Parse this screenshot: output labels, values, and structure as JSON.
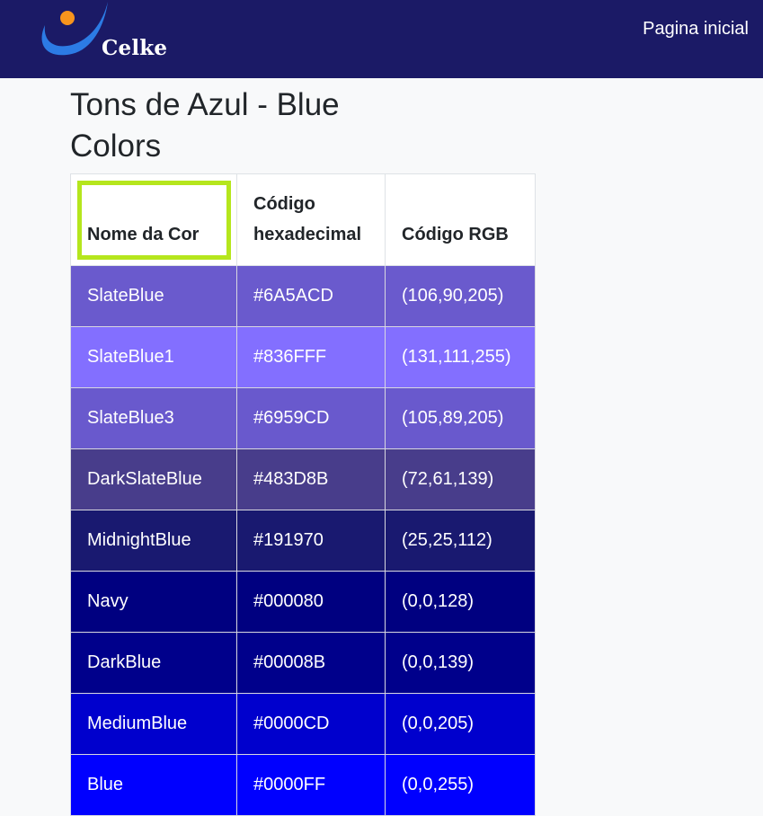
{
  "navbar": {
    "brand": "Celke",
    "link": "Pagina inicial"
  },
  "page": {
    "title": "Tons de Azul - Blue Colors"
  },
  "table": {
    "headers": [
      "Nome da Cor",
      "Código hexadecimal",
      "Código RGB"
    ],
    "rows": [
      {
        "name": "SlateBlue",
        "hex": "#6A5ACD",
        "rgb": "(106,90,205)",
        "color": "#6A5ACD"
      },
      {
        "name": "SlateBlue1",
        "hex": "#836FFF",
        "rgb": "(131,111,255)",
        "color": "#836FFF"
      },
      {
        "name": "SlateBlue3",
        "hex": "#6959CD",
        "rgb": "(105,89,205)",
        "color": "#6959CD"
      },
      {
        "name": "DarkSlateBlue",
        "hex": "#483D8B",
        "rgb": "(72,61,139)",
        "color": "#483D8B"
      },
      {
        "name": "MidnightBlue",
        "hex": "#191970",
        "rgb": "(25,25,112)",
        "color": "#191970"
      },
      {
        "name": "Navy",
        "hex": "#000080",
        "rgb": "(0,0,128)",
        "color": "#000080"
      },
      {
        "name": "DarkBlue",
        "hex": "#00008B",
        "rgb": "(0,0,139)",
        "color": "#00008B"
      },
      {
        "name": "MediumBlue",
        "hex": "#0000CD",
        "rgb": "(0,0,205)",
        "color": "#0000CD"
      },
      {
        "name": "Blue",
        "hex": "#0000FF",
        "rgb": "(0,0,255)",
        "color": "#0000FF"
      }
    ]
  },
  "colors": {
    "navbar": "#1b1a66",
    "logo_swoosh": "#2c7be5",
    "logo_dot": "#f7941d",
    "highlight": "#b5e61d"
  }
}
